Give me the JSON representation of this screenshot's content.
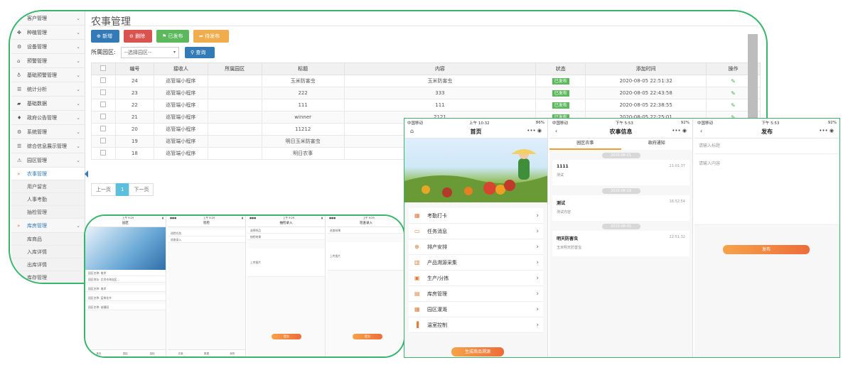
{
  "sidebar": {
    "items": [
      {
        "label": "客户管理",
        "icon": "user-icon"
      },
      {
        "label": "种植管理",
        "icon": "seedling-icon"
      },
      {
        "label": "设备管理",
        "icon": "gear-icon"
      },
      {
        "label": "预警管理",
        "icon": "home-icon"
      },
      {
        "label": "基础预警管理",
        "icon": "lightbulb-icon"
      },
      {
        "label": "统计分析",
        "icon": "list-icon"
      },
      {
        "label": "基础数据",
        "icon": "database-icon"
      },
      {
        "label": "政府公告管理",
        "icon": "flame-icon"
      },
      {
        "label": "系统管理",
        "icon": "cogs-icon"
      },
      {
        "label": "综合信息展示管理",
        "icon": "list-icon"
      },
      {
        "label": "园区管理",
        "icon": "warning-icon"
      }
    ],
    "subitems_park": [
      "农事管理",
      "用户留言",
      "人事考勤",
      "抽检管理"
    ],
    "warehouse": {
      "label": "库房管理",
      "subitems": [
        "库商品",
        "入库详情",
        "出库详情",
        "库存管理"
      ]
    }
  },
  "main": {
    "title": "农事管理",
    "buttons": {
      "add": "新增",
      "delete": "删除",
      "published": "已发布",
      "pending": "待发布"
    },
    "filter": {
      "label": "所属园区:",
      "placeholder": "--选择园区--",
      "query": "查询"
    },
    "table": {
      "headers": [
        "编号",
        "接收人",
        "所属园区",
        "标题",
        "内容",
        "状态",
        "添加时间",
        "操作"
      ],
      "rows": [
        {
          "id": "24",
          "receiver": "巡管端小程序",
          "park": "",
          "title": "玉米防害虫",
          "content": "玉米防害虫",
          "status": "已发布",
          "time": "2020-08-05 22:51:32"
        },
        {
          "id": "23",
          "receiver": "巡管端小程序",
          "park": "",
          "title": "222",
          "content": "333",
          "status": "已发布",
          "time": "2020-08-05 22:43:58"
        },
        {
          "id": "22",
          "receiver": "巡管端小程序",
          "park": "",
          "title": "111",
          "content": "111",
          "status": "已发布",
          "time": "2020-08-05 22:38:55"
        },
        {
          "id": "21",
          "receiver": "巡管端小程序",
          "park": "",
          "title": "winner",
          "content": "2121",
          "status": "已发布",
          "time": "2020-08-05 22:25:01"
        },
        {
          "id": "20",
          "receiver": "巡管端小程序",
          "park": "",
          "title": "11212",
          "content": "",
          "status": "",
          "time": ""
        },
        {
          "id": "19",
          "receiver": "巡管端小程序",
          "park": "",
          "title": "明日玉米防害虫",
          "content": "",
          "status": "",
          "time": ""
        },
        {
          "id": "18",
          "receiver": "巡管端小程序",
          "park": "",
          "title": "明日农事",
          "content": "",
          "status": "",
          "time": ""
        }
      ]
    },
    "pager": {
      "prev": "上一页",
      "current": "1",
      "next": "下一页"
    }
  },
  "phones_left": {
    "time": "上午 9:29",
    "screens": [
      {
        "title": "园区",
        "rows": [
          "园区名称: 南岸",
          "园区地址: 北京市海淀区...",
          "园区名称: 南岸",
          "园区名称: 蓝南花卉",
          "园区名称: 苗圃园"
        ]
      },
      {
        "title": "巡检",
        "rows": [
          "巡检任务",
          "巡查录入"
        ]
      },
      {
        "title": "抽检录入",
        "rows": [
          "选择样品",
          "抽检结果",
          "上传图片"
        ]
      },
      {
        "title": "巡查录入",
        "rows": [
          "巡查结果",
          "上传图片"
        ]
      }
    ],
    "submit": "提交",
    "tabs": [
      "首页",
      "园区",
      "巡检",
      "农事",
      "数据",
      "我的"
    ]
  },
  "phone_home": {
    "carrier": "中国移动",
    "time": "上午 10:32",
    "battery": "86%",
    "title": "首页",
    "menu": [
      {
        "label": "考勤打卡",
        "icon": "calendar-icon"
      },
      {
        "label": "任务消息",
        "icon": "chat-icon"
      },
      {
        "label": "排产安排",
        "icon": "plus-circle-icon"
      },
      {
        "label": "产品溯源采集",
        "icon": "barcode-icon"
      },
      {
        "label": "生产/分拣",
        "icon": "box-icon"
      },
      {
        "label": "库房管理",
        "icon": "warehouse-icon"
      },
      {
        "label": "园区灌溉",
        "icon": "grid-icon"
      },
      {
        "label": "温室控制",
        "icon": "bars-icon"
      }
    ],
    "cta": "生成商品溯源"
  },
  "phone_farm": {
    "carrier": "中国移动",
    "time": "下午 5:53",
    "battery": "92%",
    "title": "农事信息",
    "tabs": [
      "园区农事",
      "政府通知"
    ],
    "groups": [
      {
        "date": "2020-08-21",
        "title": "1111",
        "sub": "测试",
        "time": "11:01:37"
      },
      {
        "date": "2020-08-19",
        "title": "测试",
        "sub": "测试内容",
        "time": "16:52:54"
      },
      {
        "date": "2020-08-05",
        "title": "明天防害虫",
        "sub": "玉米明天防害虫",
        "time": "22:51:32"
      }
    ]
  },
  "phone_publish": {
    "carrier": "中国移动",
    "time": "下午 5:53",
    "battery": "92%",
    "title": "发布",
    "title_placeholder": "请输入标题",
    "content_placeholder": "请输入内容",
    "submit": "发布"
  },
  "colors": {
    "frame": "#38b56a",
    "primary": "#337ab7",
    "danger": "#d9534f",
    "success": "#5cb85c",
    "warning": "#f0ad4e",
    "accent": "#ee6c3a"
  }
}
